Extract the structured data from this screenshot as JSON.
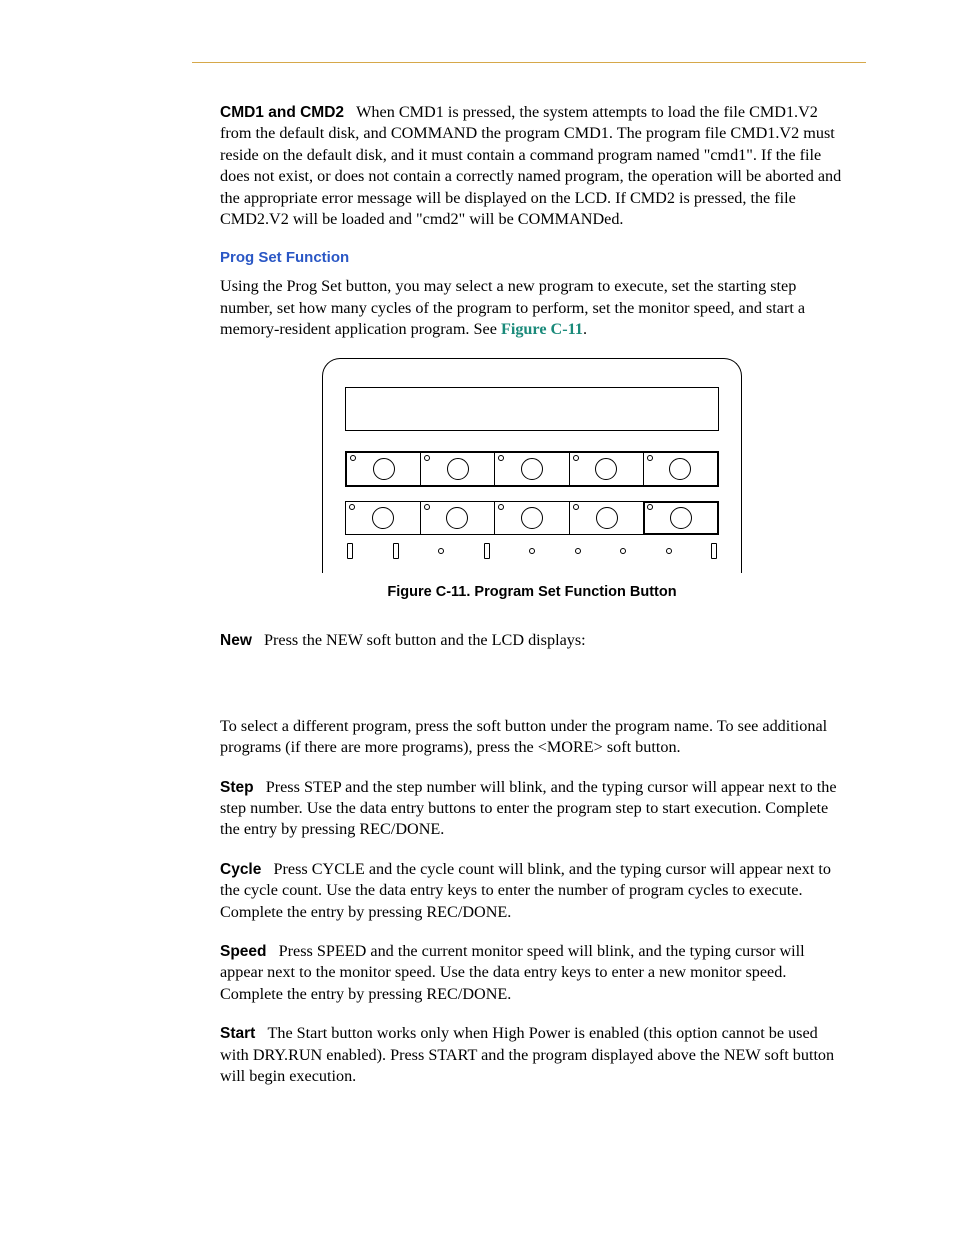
{
  "sections": {
    "cmd": {
      "heading": "CMD1 and CMD2",
      "body": "When CMD1 is pressed, the system attempts to load the file CMD1.V2 from the default disk, and COMMAND the program CMD1.   The program file CMD1.V2 must reside on the default disk, and it must contain a command program named \"cmd1\". If the file does not exist, or does not contain a correctly named program, the operation will be aborted and the appropriate error message will be displayed on the LCD. If CMD2 is pressed, the file CMD2.V2 will be loaded and \"cmd2\" will be COMMANDed."
    },
    "progset": {
      "heading": "Prog Set Function",
      "body_pre": "Using the Prog Set button, you may select a new program to execute, set the starting step number, set how many cycles of the program to perform, set the monitor speed, and start a memory-resident application program. See ",
      "figref": "Figure C-11",
      "body_post": "."
    },
    "figure": {
      "caption": "Figure C-11. Program Set Function Button"
    },
    "new": {
      "heading": "New",
      "body": "Press the NEW soft button and the LCD displays:"
    },
    "select": {
      "body": "To select a different program, press the soft button under the program name. To see additional programs (if there are more programs), press the <MORE> soft button."
    },
    "step": {
      "heading": "Step",
      "body": "Press STEP and the step number will blink, and the typing cursor will appear next to the step number. Use the data entry buttons to enter the program step to start execution. Complete the entry by pressing REC/DONE."
    },
    "cycle": {
      "heading": "Cycle",
      "body": "Press CYCLE and the cycle count will blink, and the typing cursor will appear next to the cycle count. Use the data entry keys to enter the number of program cycles to execute. Complete the entry by pressing REC/DONE."
    },
    "speed": {
      "heading": "Speed",
      "body": "Press SPEED and the current monitor speed will blink, and the typing cursor will appear next to the monitor speed. Use the data entry keys to enter a new monitor speed. Complete the entry by pressing REC/DONE."
    },
    "start": {
      "heading": "Start",
      "body": "The Start button works only when High Power is enabled (this option cannot be used with DRY.RUN enabled). Press START and the program displayed above the NEW soft button will begin execution."
    }
  }
}
